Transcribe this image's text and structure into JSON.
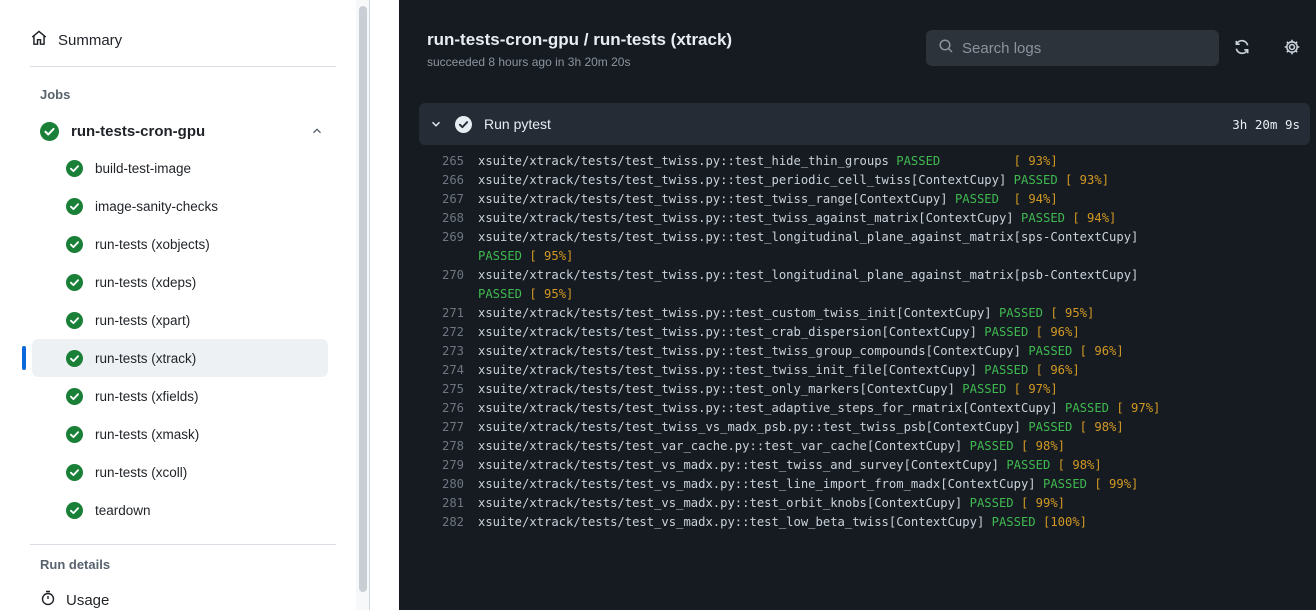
{
  "sidebar": {
    "summary_label": "Summary",
    "jobs_label": "Jobs",
    "job_name": "run-tests-cron-gpu",
    "steps": [
      {
        "label": "build-test-image"
      },
      {
        "label": "image-sanity-checks"
      },
      {
        "label": "run-tests (xobjects)"
      },
      {
        "label": "run-tests (xdeps)"
      },
      {
        "label": "run-tests (xpart)"
      },
      {
        "label": "run-tests (xtrack)",
        "active": true
      },
      {
        "label": "run-tests (xfields)"
      },
      {
        "label": "run-tests (xmask)"
      },
      {
        "label": "run-tests (xcoll)"
      },
      {
        "label": "teardown"
      }
    ],
    "run_details_label": "Run details",
    "usage_label": "Usage"
  },
  "header": {
    "title": "run-tests-cron-gpu / run-tests (xtrack)",
    "subtitle": "succeeded 8 hours ago in 3h 20m 20s",
    "search_placeholder": "Search logs"
  },
  "step": {
    "label": "Run pytest",
    "duration": "3h 20m 9s"
  },
  "colors": {
    "accent": "#0969da",
    "success": "#1a7f37",
    "passed_text": "#3fb950",
    "percent_text": "#d29922",
    "log_bg": "#161b22"
  },
  "log_lines": [
    {
      "num": "265",
      "text": "xsuite/xtrack/tests/test_twiss.py::test_hide_thin_groups ",
      "status": "PASSED",
      "pct": "          [ 93%]"
    },
    {
      "num": "266",
      "text": "xsuite/xtrack/tests/test_twiss.py::test_periodic_cell_twiss[ContextCupy] ",
      "status": "PASSED",
      "pct": " [ 93%]"
    },
    {
      "num": "267",
      "text": "xsuite/xtrack/tests/test_twiss.py::test_twiss_range[ContextCupy] ",
      "status": "PASSED",
      "pct": "  [ 94%]"
    },
    {
      "num": "268",
      "text": "xsuite/xtrack/tests/test_twiss.py::test_twiss_against_matrix[ContextCupy] ",
      "status": "PASSED",
      "pct": " [ 94%]"
    },
    {
      "num": "269",
      "text": "xsuite/xtrack/tests/test_twiss.py::test_longitudinal_plane_against_matrix[sps-ContextCupy]",
      "status": "",
      "pct": ""
    },
    {
      "num": "",
      "text": "",
      "status": "PASSED",
      "pct": " [ 95%]"
    },
    {
      "num": "270",
      "text": "xsuite/xtrack/tests/test_twiss.py::test_longitudinal_plane_against_matrix[psb-ContextCupy]",
      "status": "",
      "pct": ""
    },
    {
      "num": "",
      "text": "",
      "status": "PASSED",
      "pct": " [ 95%]"
    },
    {
      "num": "271",
      "text": "xsuite/xtrack/tests/test_twiss.py::test_custom_twiss_init[ContextCupy] ",
      "status": "PASSED",
      "pct": " [ 95%]"
    },
    {
      "num": "272",
      "text": "xsuite/xtrack/tests/test_twiss.py::test_crab_dispersion[ContextCupy] ",
      "status": "PASSED",
      "pct": " [ 96%]"
    },
    {
      "num": "273",
      "text": "xsuite/xtrack/tests/test_twiss.py::test_twiss_group_compounds[ContextCupy] ",
      "status": "PASSED",
      "pct": " [ 96%]"
    },
    {
      "num": "274",
      "text": "xsuite/xtrack/tests/test_twiss.py::test_twiss_init_file[ContextCupy] ",
      "status": "PASSED",
      "pct": " [ 96%]"
    },
    {
      "num": "275",
      "text": "xsuite/xtrack/tests/test_twiss.py::test_only_markers[ContextCupy] ",
      "status": "PASSED",
      "pct": " [ 97%]"
    },
    {
      "num": "276",
      "text": "xsuite/xtrack/tests/test_twiss.py::test_adaptive_steps_for_rmatrix[ContextCupy] ",
      "status": "PASSED",
      "pct": " [ 97%]"
    },
    {
      "num": "277",
      "text": "xsuite/xtrack/tests/test_twiss_vs_madx_psb.py::test_twiss_psb[ContextCupy] ",
      "status": "PASSED",
      "pct": " [ 98%]"
    },
    {
      "num": "278",
      "text": "xsuite/xtrack/tests/test_var_cache.py::test_var_cache[ContextCupy] ",
      "status": "PASSED",
      "pct": " [ 98%]"
    },
    {
      "num": "279",
      "text": "xsuite/xtrack/tests/test_vs_madx.py::test_twiss_and_survey[ContextCupy] ",
      "status": "PASSED",
      "pct": " [ 98%]"
    },
    {
      "num": "280",
      "text": "xsuite/xtrack/tests/test_vs_madx.py::test_line_import_from_madx[ContextCupy] ",
      "status": "PASSED",
      "pct": " [ 99%]"
    },
    {
      "num": "281",
      "text": "xsuite/xtrack/tests/test_vs_madx.py::test_orbit_knobs[ContextCupy] ",
      "status": "PASSED",
      "pct": " [ 99%]"
    },
    {
      "num": "282",
      "text": "xsuite/xtrack/tests/test_vs_madx.py::test_low_beta_twiss[ContextCupy] ",
      "status": "PASSED",
      "pct": " [100%]"
    }
  ]
}
